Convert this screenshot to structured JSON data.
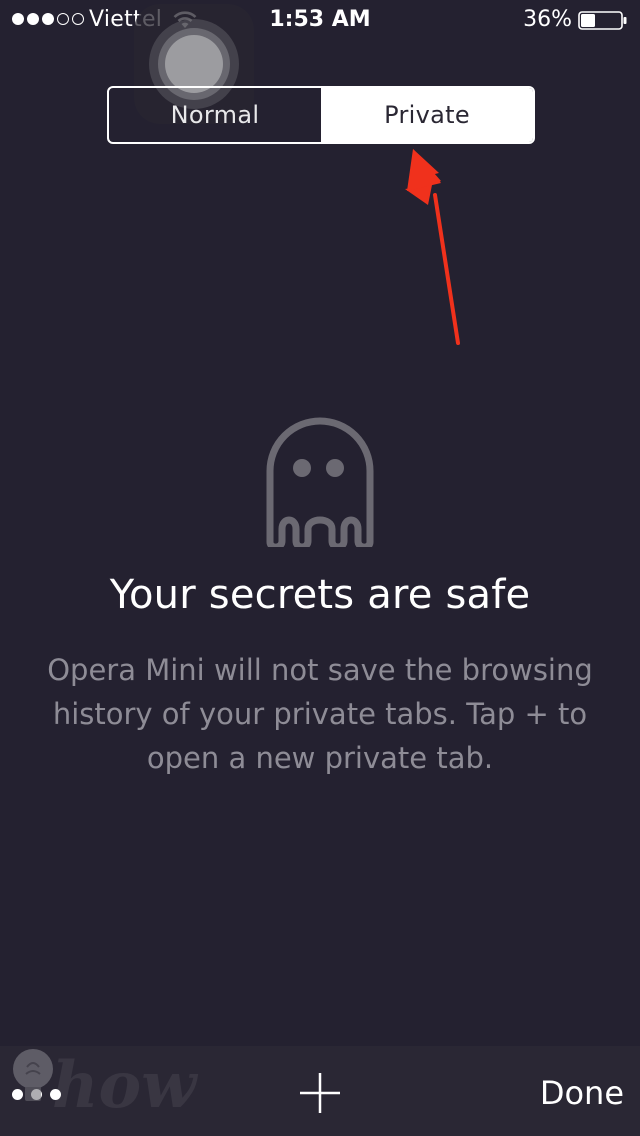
{
  "status_bar": {
    "carrier": "Viettel",
    "time": "1:53 AM",
    "battery_percent": "36%",
    "signal_bars_filled": 3,
    "signal_bars_total": 5,
    "battery_level": 0.36
  },
  "segmented_control": {
    "normal_label": "Normal",
    "private_label": "Private",
    "selected": "Private"
  },
  "private_info": {
    "icon": "ghost-icon",
    "headline": "Your secrets are safe",
    "description": "Opera Mini will not save the browsing history of your private tabs. Tap + to open a new private tab."
  },
  "toolbar": {
    "more_icon": "more-dots-icon",
    "add_icon": "plus-icon",
    "done_label": "Done"
  },
  "watermark": {
    "text": "how"
  },
  "colors": {
    "background": "#242130",
    "toolbar": "#2a2734",
    "annotation_arrow": "#f0311c",
    "description_text": "#8e8c96",
    "ghost_stroke": "#6b6972"
  }
}
